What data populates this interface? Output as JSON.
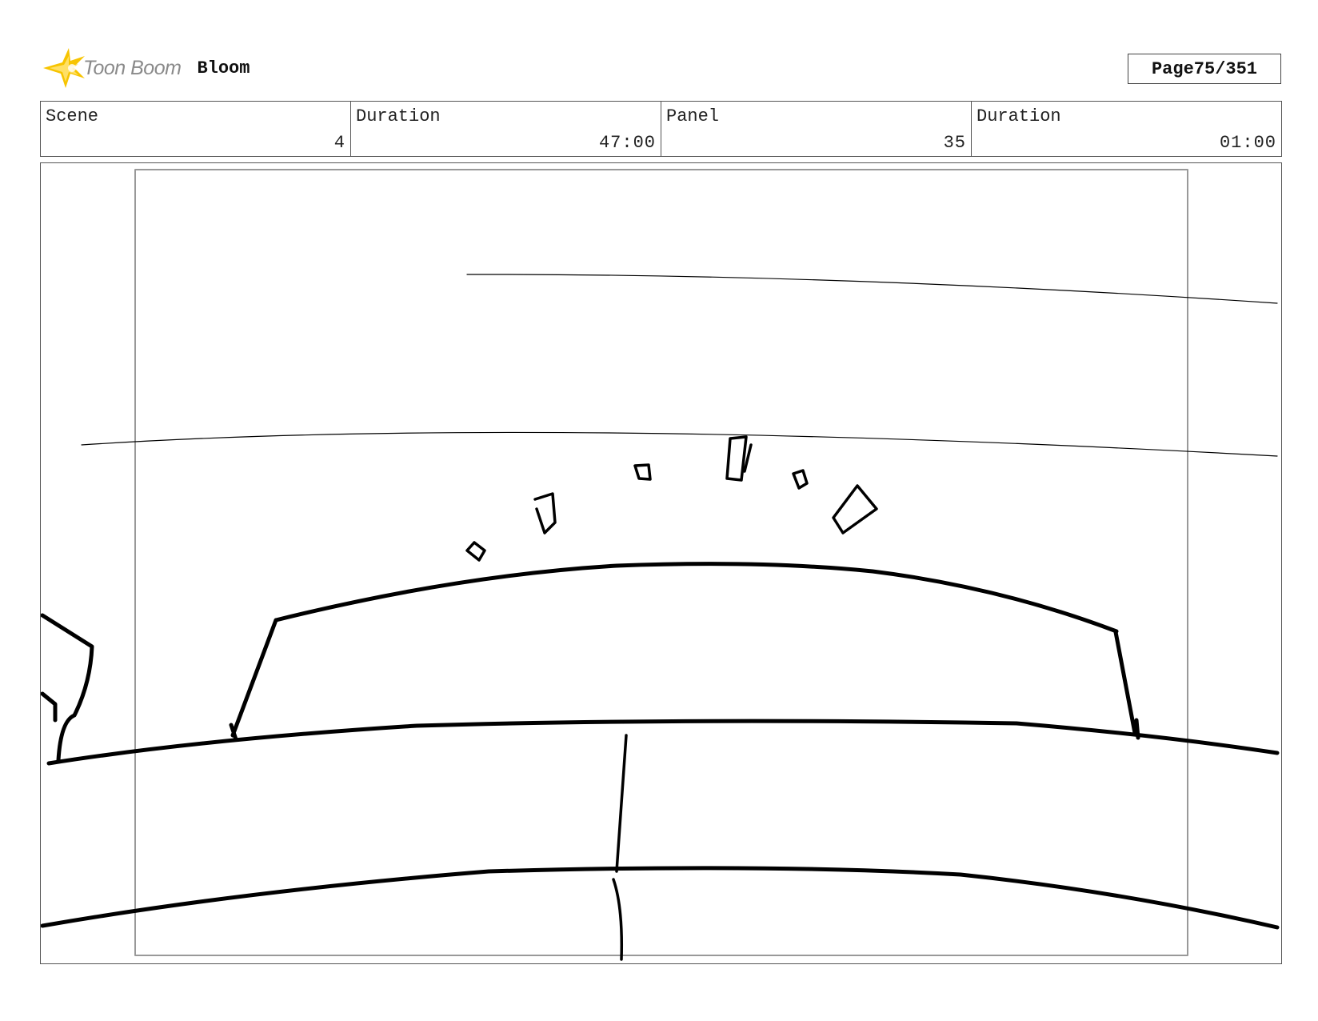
{
  "header": {
    "brand": "Toon Boom",
    "project": "Bloom",
    "page_label": "Page",
    "page_value": "75/351"
  },
  "info": [
    {
      "label": "Scene",
      "value": "4"
    },
    {
      "label": "Duration",
      "value": "47:00"
    },
    {
      "label": "Panel",
      "value": "35"
    },
    {
      "label": "Duration",
      "value": "01:00"
    }
  ],
  "colors": {
    "logo_accent": "#f7c400",
    "ink": "#000000",
    "frame": "#999999"
  },
  "icons": {
    "logo": "starburst-icon"
  }
}
